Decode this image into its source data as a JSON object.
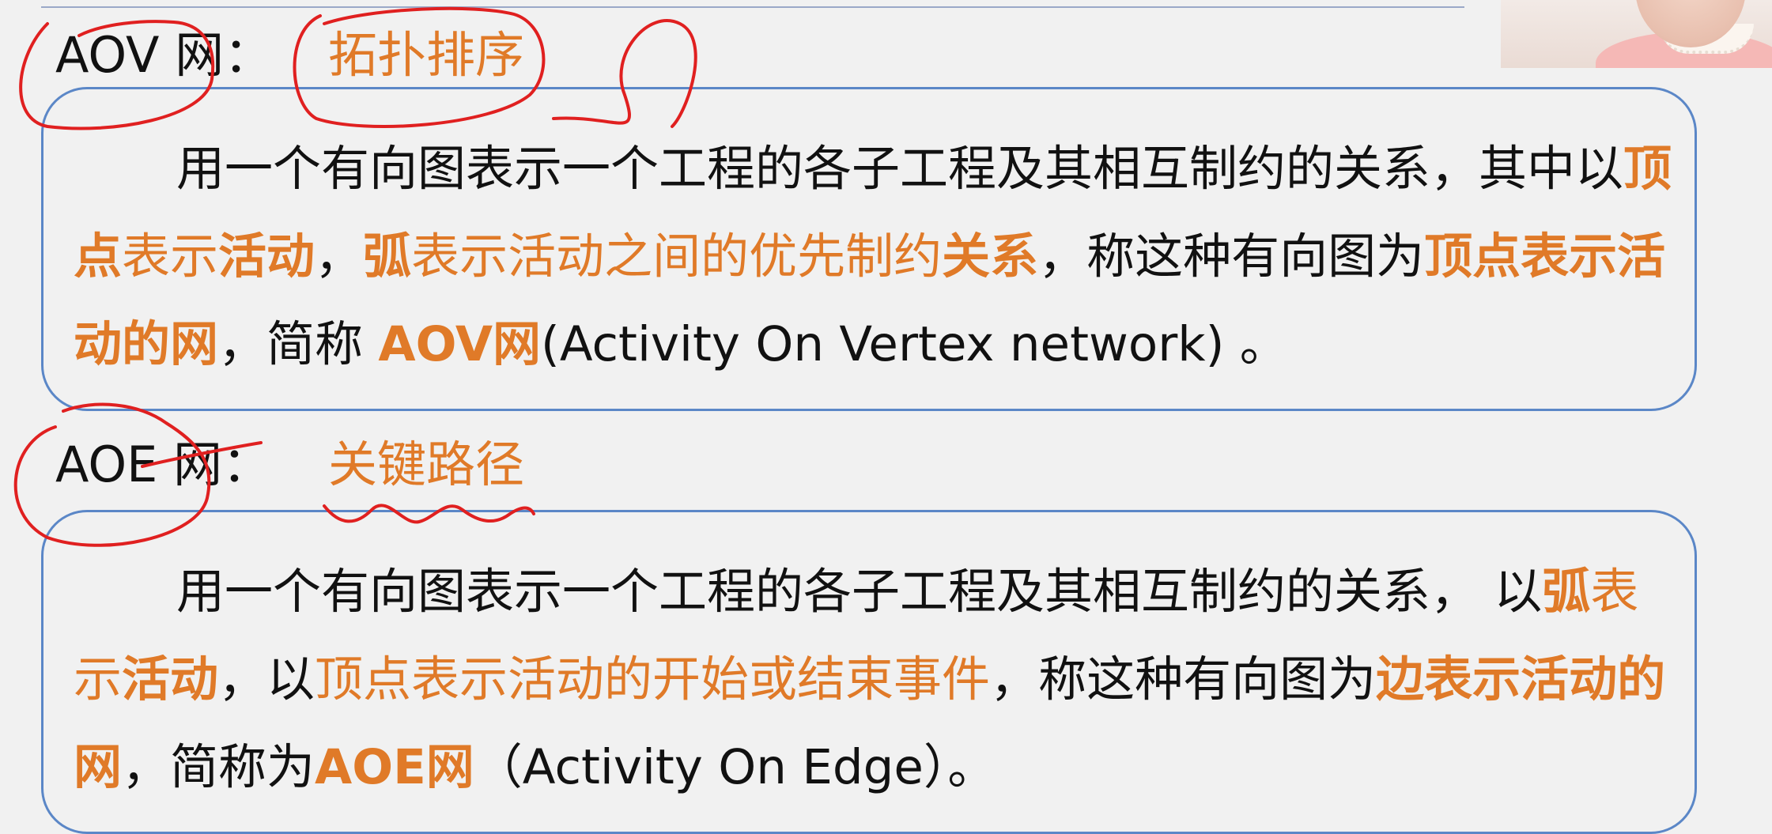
{
  "aov": {
    "label": "AOV 网：",
    "note": "拓扑排序",
    "definition": {
      "t1": "用一个有向图表示一个工程的各子工程及其相互制约的关系，其中以",
      "t2": "顶点",
      "t3": "表示",
      "t4": "活动",
      "t5": "，",
      "t6": "弧",
      "t7": "表示活动之间的优先制约",
      "t8": "关系",
      "t9": "，称这种有向图为",
      "t10": "顶点表示活动的网",
      "t11": "，简称 ",
      "t12": "AOV网",
      "t13": "(Activity On Vertex network) 。"
    }
  },
  "aoe": {
    "label": "AOE 网：",
    "note": "关键路径",
    "definition": {
      "t1": "用一个有向图表示一个工程的各子工程及其相互制约的关系， 以",
      "t2": "弧",
      "t3": "表示",
      "t4": "活动",
      "t5": "，以",
      "t6": "顶点表示活动的开始或结束事件",
      "t7": "，称这种有向图为",
      "t8": "边表示活动的网",
      "t9": "，简称为",
      "t10": "AOE网",
      "t11": "（Activity  On  Edge）。"
    }
  },
  "colors": {
    "highlight": "#e07a28",
    "card_border": "#5b87c7",
    "ink_annotation": "#e02020",
    "background": "#f1f1f1"
  }
}
